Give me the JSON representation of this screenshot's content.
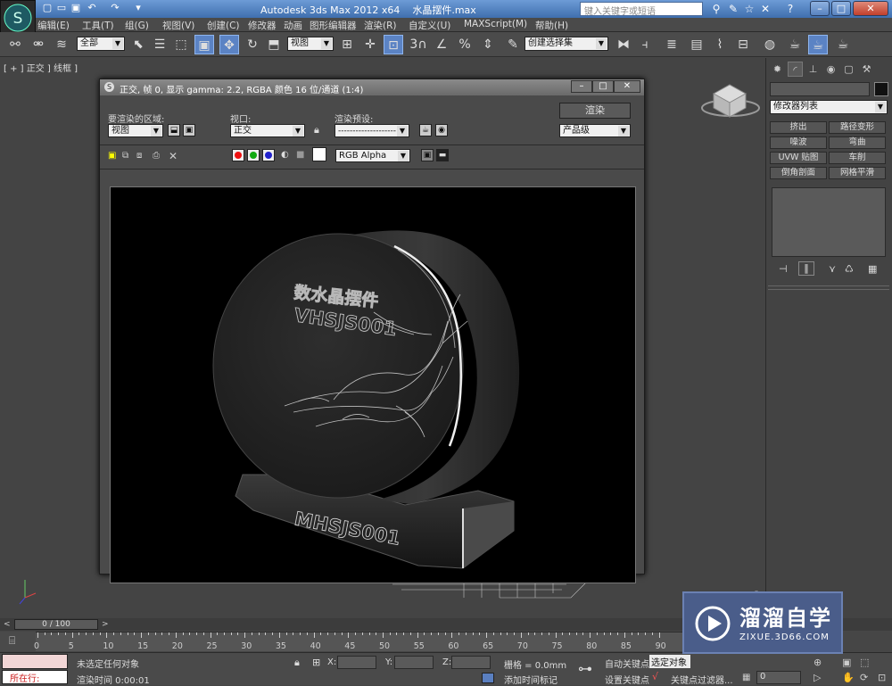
{
  "app": {
    "title": "Autodesk 3ds Max  2012 x64",
    "file": "水晶摆件.max",
    "search_placeholder": "键入关键字或短语"
  },
  "menu": [
    "编辑(E)",
    "工具(T)",
    "组(G)",
    "视图(V)",
    "创建(C)",
    "修改器",
    "动画",
    "图形编辑器",
    "渲染(R)",
    "自定义(U)",
    "MAXScript(M)",
    "帮助(H)"
  ],
  "toolbar": {
    "selection_filter": "全部",
    "view_dropdown": "视图",
    "named_selection": "创建选择集"
  },
  "viewport": {
    "label": "[ + ] 正交 ] 线框 ]"
  },
  "render_window": {
    "title": "正交, 帧 0, 显示 gamma: 2.2, RGBA 颜色 16 位/通道 (1:4)",
    "area_label": "要渲染的区域:",
    "area_value": "视图",
    "viewport_label": "视口:",
    "viewport_value": "正交",
    "preset_label": "渲染预设:",
    "preset_value": "--------------------",
    "render_button": "渲染",
    "quality_value": "产品级",
    "channel_value": "RGB Alpha",
    "image_text_top_line1": "数水晶摆件",
    "image_text_top_line2": "VHSJS001",
    "image_text_base": "MHSJS001"
  },
  "command_panel": {
    "modifier_list": "修改器列表",
    "buttons": [
      "挤出",
      "路径变形",
      "噪波",
      "弯曲",
      "UVW 贴图",
      "车削",
      "倒角剖面",
      "网格平滑"
    ]
  },
  "timeline": {
    "frame": "0 / 100",
    "ticks": [
      "0",
      "5",
      "10",
      "15",
      "20",
      "25",
      "30",
      "35",
      "40",
      "45",
      "50",
      "55",
      "60",
      "65",
      "70",
      "75",
      "80",
      "85",
      "90"
    ]
  },
  "status": {
    "running": "所在行:",
    "selection": "未选定任何对象",
    "render_time": "渲染时间  0:00:01",
    "x_label": "X:",
    "y_label": "Y:",
    "z_label": "Z:",
    "grid": "栅格 = 0.0mm",
    "add_time_tag": "添加时间标记",
    "auto_key": "自动关键点",
    "set_key": "设置关键点",
    "selected_obj": "选定对象",
    "key_filters": "关键点过滤器...",
    "frame_field": "0"
  },
  "watermark": {
    "brand": "溜溜自学",
    "url": "ZIXUE.3D66.COM"
  }
}
